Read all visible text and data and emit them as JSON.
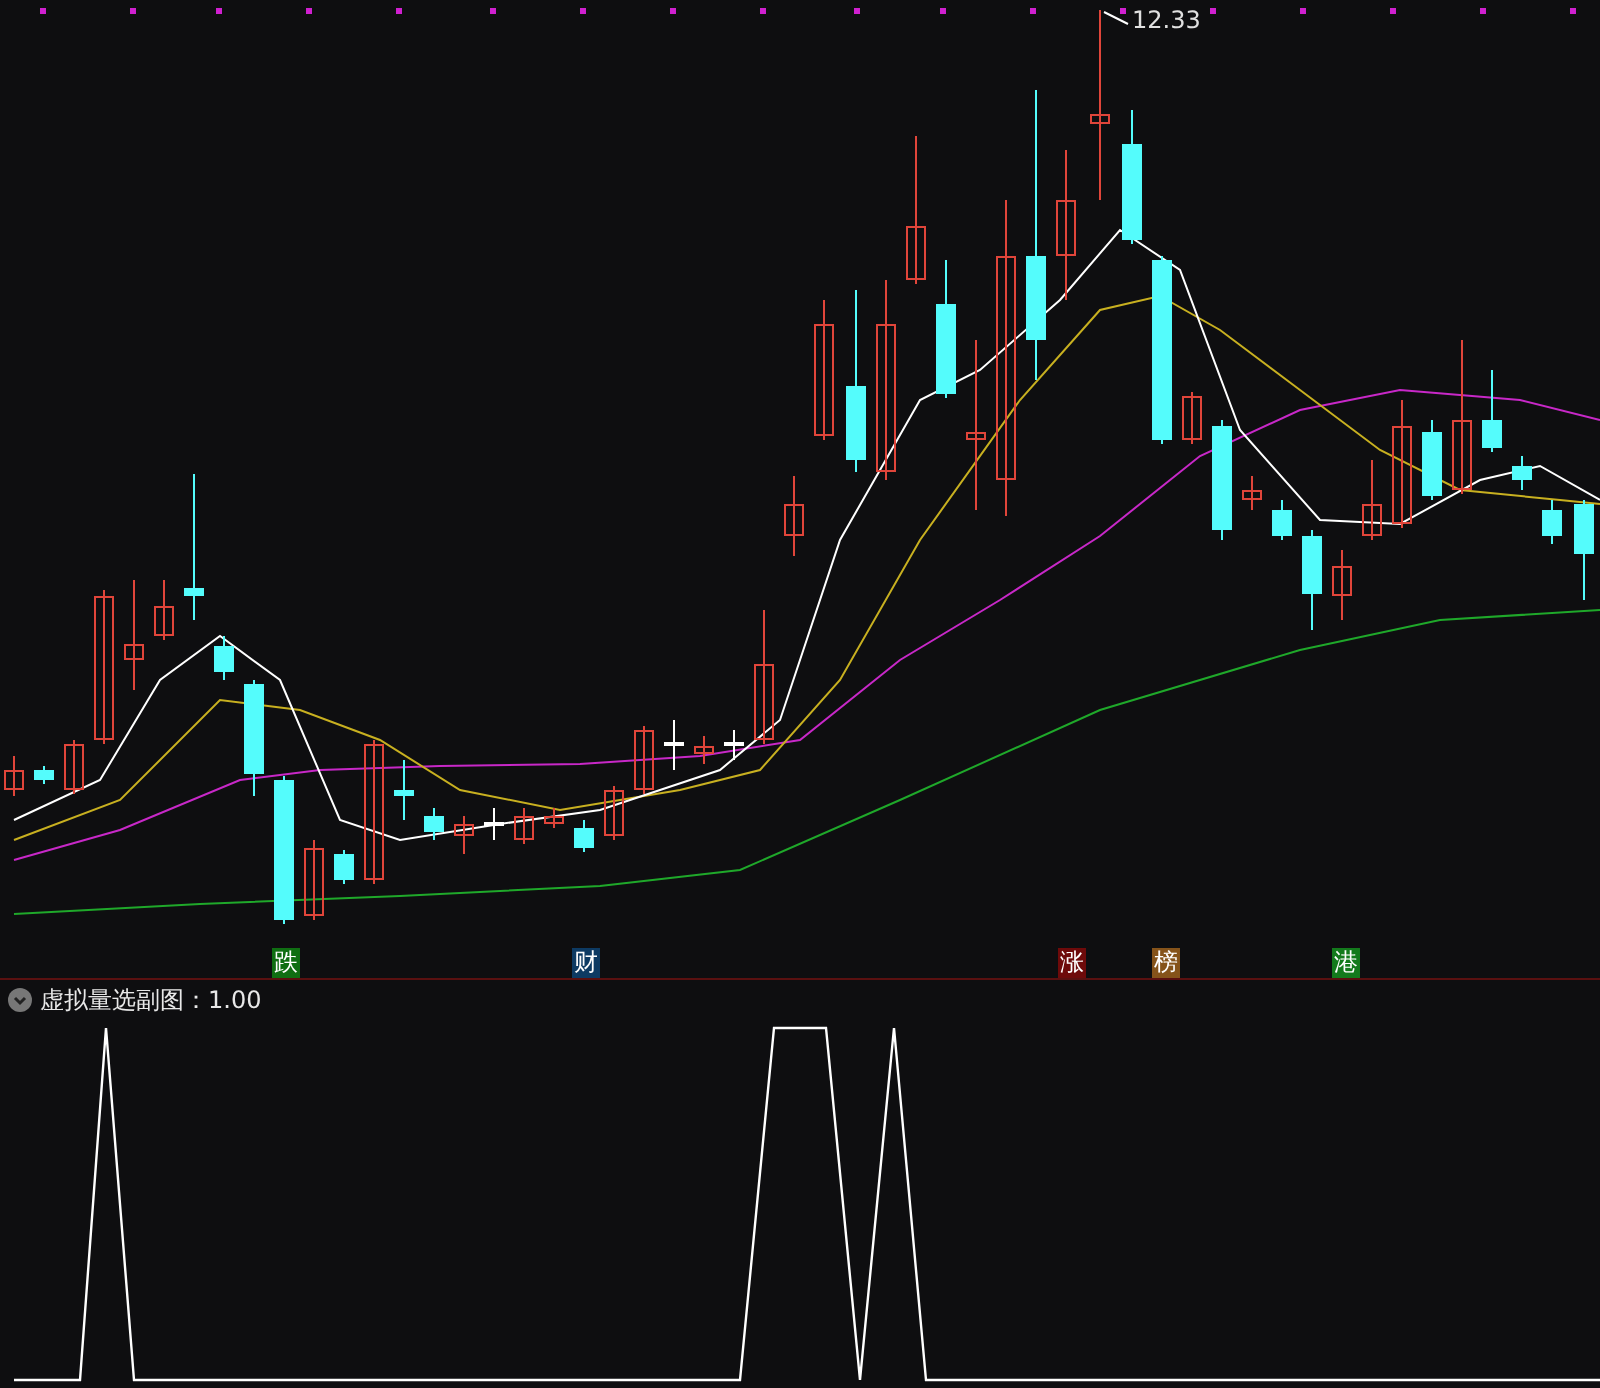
{
  "price_chart": {
    "high_label": "12.33",
    "markers": [
      {
        "text": "跌",
        "color": "#0f6e12"
      },
      {
        "text": "财",
        "color": "#0d3a63"
      },
      {
        "text": "涨",
        "color": "#6e0a0a"
      },
      {
        "text": "榜",
        "color": "#85531a"
      },
      {
        "text": "港",
        "color": "#137a1c"
      }
    ]
  },
  "indicator_panel": {
    "title": "虚拟量选副图：1.00"
  }
}
